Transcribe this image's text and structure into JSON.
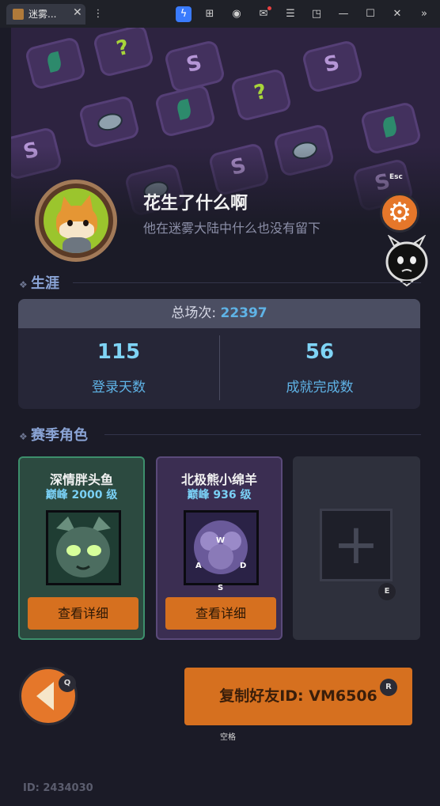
{
  "browser": {
    "tab_title": "迷雾...",
    "icons": [
      "bolt-icon",
      "gamepad-icon",
      "account-icon",
      "mail-icon",
      "menu-icon",
      "crop-icon",
      "minimize-icon",
      "maximize-icon",
      "close-icon",
      "more-icon"
    ]
  },
  "profile": {
    "name": "花生了什么啊",
    "subtitle": "他在迷雾大陆中什么也没有留下"
  },
  "hotkeys": {
    "settings": "Esc",
    "back": "Q",
    "copy": "R",
    "add": "E",
    "space": "空格"
  },
  "career": {
    "heading": "生涯",
    "total_label": "总场次: ",
    "total_value": "22397",
    "stats": [
      {
        "value": "115",
        "label": "登录天数"
      },
      {
        "value": "56",
        "label": "成就完成数"
      }
    ]
  },
  "season": {
    "heading": "赛季角色",
    "characters": [
      {
        "name": "深情胖头鱼",
        "level": "巅峰 2000 级",
        "button": "查看详细"
      },
      {
        "name": "北极熊小绵羊",
        "level": "巅峰 936 级",
        "button": "查看详细"
      }
    ],
    "empty_slot_symbol": "+",
    "wasd": [
      "W",
      "A",
      "D",
      "S"
    ]
  },
  "copy_button_label": "复制好友ID: VM6506",
  "player_id": "ID: 2434030",
  "colors": {
    "accent_orange": "#d6701f",
    "stat_blue": "#7fd4f5",
    "teal_card": "#2c4a40",
    "purple_card": "#3b2e52"
  }
}
